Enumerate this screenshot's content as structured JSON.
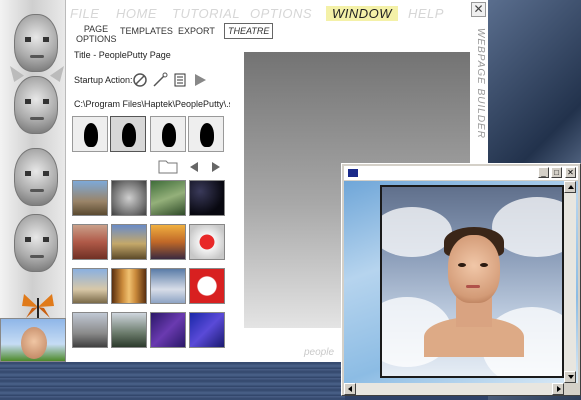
{
  "menu": {
    "items": [
      "FILE",
      "HOME",
      "TUTORIAL",
      "OPTIONS",
      "WINDOW",
      "HELP"
    ],
    "active": "WINDOW",
    "close_glyph": "✕"
  },
  "subtabs": {
    "page_options": "PAGE OPTIONS",
    "templates": "TEMPLATES",
    "export": "EXPORT",
    "theatre": "THEATRE"
  },
  "settings": {
    "title_label": "Title",
    "title_value": "PeoplePutty Page",
    "startup_label": "Startup Action:",
    "path_value": "C:\\Program Files\\Haptek\\PeoplePutty\\.se"
  },
  "side_label": "WEBPAGE BUILDER",
  "brand": "people",
  "theatre_window": {
    "minimize": "_",
    "maximize": "□",
    "close": "✕"
  },
  "icons": {
    "startup": [
      "no-action-icon",
      "magic-wand-icon",
      "document-icon",
      "play-icon"
    ],
    "nav": [
      "folder-icon",
      "arrow-left-icon",
      "arrow-right-icon"
    ]
  },
  "colors": {
    "menu_inactive": "#d6d6d6",
    "menu_active_bg": "#f4f1a8",
    "preview_top": "#737373",
    "win_face": "#d4d0c8"
  }
}
